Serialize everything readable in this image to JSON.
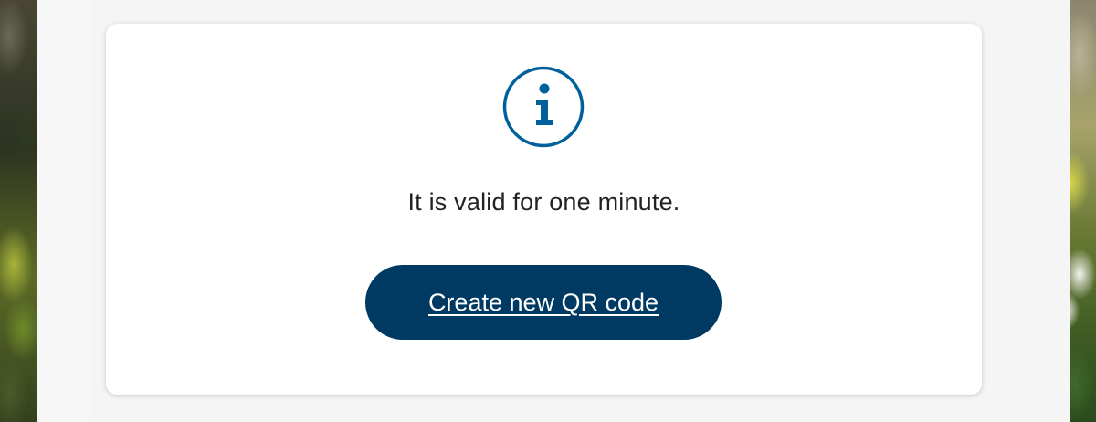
{
  "colors": {
    "accent": "#00609c",
    "button_bg": "#003a63",
    "card_bg": "#ffffff",
    "text": "#222222"
  },
  "notice": {
    "icon": "info-icon",
    "message": "It is valid for one minute."
  },
  "actions": {
    "create_qr_label": "Create new QR code"
  }
}
